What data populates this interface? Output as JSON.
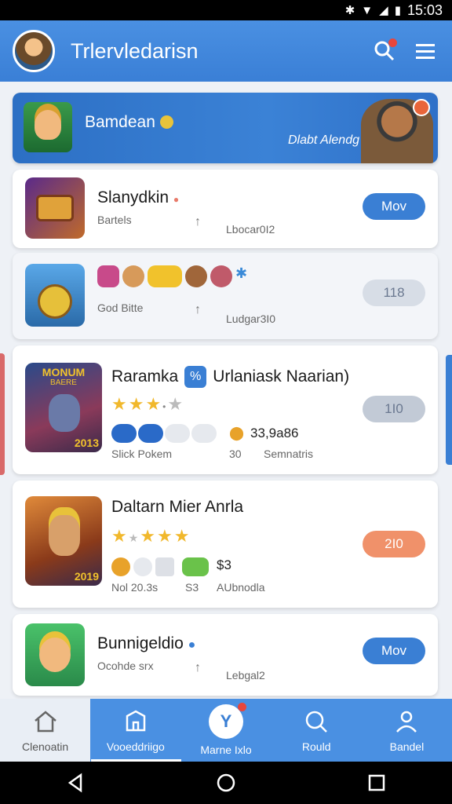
{
  "status": {
    "time": "15:03"
  },
  "header": {
    "title": "Trlervledarisn"
  },
  "banner": {
    "title": "Bamdean",
    "subtitle": "Dlabt Alendg"
  },
  "cards": [
    {
      "title": "Slanydkin",
      "sub1": "Bartels",
      "sub2": "Lbocar0I2",
      "button": "Mov"
    },
    {
      "sub1": "God Bitte",
      "sub2": "Ludgar3I0",
      "button": "118"
    },
    {
      "title_a": "Raramka",
      "badge": "%",
      "title_b": "Urlaniask Naarian)",
      "stars": 3,
      "stat": "33,9a86",
      "label1": "Slick Pokem",
      "label2": "30",
      "label3": "Semnatris",
      "button": "1I0"
    },
    {
      "title": "Daltarn Mier Anrla",
      "stars": 4,
      "stat": "$3",
      "label1": "Nol 20.3s",
      "label2": "S3",
      "label3": "AUbnodla",
      "button": "2I0"
    },
    {
      "title": "Bunnigeldio",
      "sub1": "Ocohde srx",
      "sub2": "Lebgal2",
      "button": "Mov"
    }
  ],
  "thumbs": {
    "card3": "2013",
    "card4": "2019",
    "card3_top": "MONUM",
    "card3_top2": "BAERE"
  },
  "nav": [
    {
      "label": "Clenoatin",
      "icon": "home-icon"
    },
    {
      "label": "Vooeddriigo",
      "icon": "library-icon"
    },
    {
      "label": "Marne Ixlo",
      "icon": "y-logo-icon"
    },
    {
      "label": "Rould",
      "icon": "search-icon"
    },
    {
      "label": "Bandel",
      "icon": "profile-icon"
    }
  ],
  "colors": {
    "primary": "#4a90e2",
    "accent_orange": "#f0916a",
    "badge_red": "#e8463c",
    "star": "#f1b82c"
  }
}
